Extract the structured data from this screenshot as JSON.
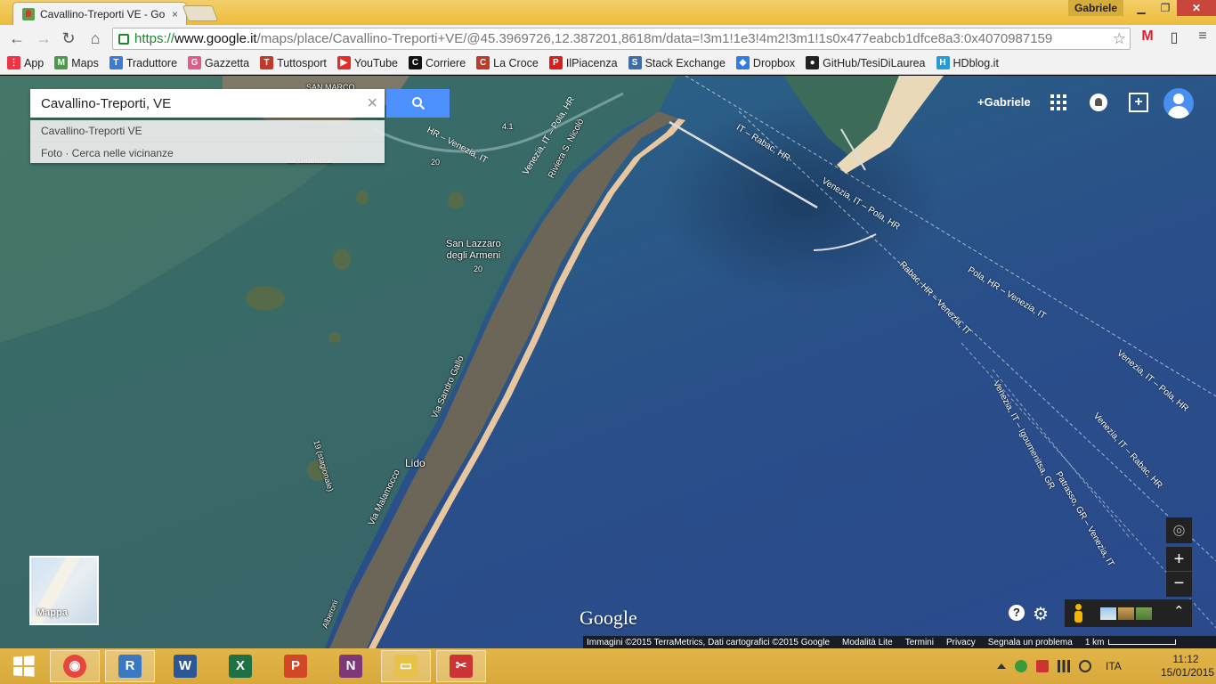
{
  "browser": {
    "tab_title": "Cavallino-Treporti VE - Go",
    "tab_close": "×",
    "user_badge": "Gabriele",
    "win_min": "▁",
    "win_max": "❐",
    "win_close": "✕",
    "url_scheme": "https://",
    "url_host": "www.google.it",
    "url_path": "/maps/place/Cavallino-Treporti+VE/@45.3969726,12.387201,8618m/data=!3m1!1e3!4m2!3m1!1s0x477eabcb1dfce8a3:0x4070987159",
    "back": "←",
    "forward": "→",
    "reload": "↻",
    "home": "⌂",
    "star": "☆",
    "gmail": "M",
    "ext": "▯",
    "menu": "≡"
  },
  "bookmarks": [
    {
      "label": "App",
      "color": "#e34",
      "glyph": "⋮"
    },
    {
      "label": "Maps",
      "color": "#4a9a4a",
      "glyph": "M"
    },
    {
      "label": "Traduttore",
      "color": "#3a7bd5",
      "glyph": "T"
    },
    {
      "label": "Gazzetta",
      "color": "#e05a8a",
      "glyph": "G"
    },
    {
      "label": "Tuttosport",
      "color": "#c0392b",
      "glyph": "T"
    },
    {
      "label": "YouTube",
      "color": "#e52d27",
      "glyph": "▶"
    },
    {
      "label": "Corriere",
      "color": "#111",
      "glyph": "C"
    },
    {
      "label": "La Croce",
      "color": "#c0392b",
      "glyph": "C"
    },
    {
      "label": "IlPiacenza",
      "color": "#d62020",
      "glyph": "P"
    },
    {
      "label": "Stack Exchange",
      "color": "#3d6ea8",
      "glyph": "S"
    },
    {
      "label": "Dropbox",
      "color": "#2d7ee0",
      "glyph": "◆"
    },
    {
      "label": "GitHub/TesiDiLaurea",
      "color": "#222",
      "glyph": "●"
    },
    {
      "label": "HDblog.it",
      "color": "#2a9ad6",
      "glyph": "H"
    }
  ],
  "search": {
    "value": "Cavallino-Treporti, VE",
    "clear": "×",
    "suggestions": [
      "Cavallino-Treporti VE",
      "Foto · Cerca nelle vicinanze"
    ]
  },
  "topright": {
    "gplus": "+Gabriele",
    "share": "+"
  },
  "map_labels": {
    "san_lazzaro": "San Lazzaro\ndegli Armeni",
    "lido": "Lido",
    "riviera": "Riviera S. Nicolò",
    "via_sandro_gallo": "Via Sandro Gallo",
    "via_malamocco": "Via Malamocco",
    "route_20a": "20",
    "route_20b": "20",
    "route_41": "4.1",
    "route_19": "19 (stagionale)",
    "san_marco": "SAN MARCO",
    "la_giudecca": "La Giudecca",
    "alberoni": "Alberoni",
    "ferry_1": "HR – Venezia, IT",
    "ferry_2": "Venezia, IT – Pola, HR",
    "ferry_3": "IT – Rabac, HR",
    "ferry_4": "Venezia, IT – Pola, HR",
    "ferry_5": "Rabac, HR – Venezia, IT",
    "ferry_6": "Pola, HR – Venezia, IT",
    "ferry_7": "Venezia, IT – Pola, HR",
    "ferry_8": "Venezia, IT – Rabac, HR",
    "ferry_9": "Venezia, IT – Igoumenitsa, GR",
    "ferry_10": "Patrasso, GR – Venezia, IT"
  },
  "map_controls": {
    "mappa": "Mappa",
    "locate": "◎",
    "zoom_in": "+",
    "zoom_out": "−",
    "help": "?",
    "settings": "⚙",
    "expand": "⌃"
  },
  "footer": {
    "logo": "Google",
    "imagery": "Immagini ©2015 TerraMetrics, Dati cartografici ©2015 Google",
    "lite": "Modalità Lite",
    "terms": "Termini",
    "privacy": "Privacy",
    "report": "Segnala un problema",
    "scale": "1 km"
  },
  "taskbar": {
    "apps": [
      {
        "name": "chrome",
        "glyph": "◉",
        "color": "#e8453c"
      },
      {
        "name": "r",
        "glyph": "R",
        "color": "#3b78c2"
      },
      {
        "name": "word",
        "glyph": "W",
        "color": "#2b5797"
      },
      {
        "name": "excel",
        "glyph": "X",
        "color": "#1e7145"
      },
      {
        "name": "powerpoint",
        "glyph": "P",
        "color": "#d24726"
      },
      {
        "name": "onenote",
        "glyph": "N",
        "color": "#7e3878"
      },
      {
        "name": "explorer",
        "glyph": "▭",
        "color": "#e8c14a"
      },
      {
        "name": "snipping",
        "glyph": "✂",
        "color": "#c33"
      }
    ],
    "lang": "ITA",
    "time": "11:12",
    "date": "15/01/2015"
  }
}
